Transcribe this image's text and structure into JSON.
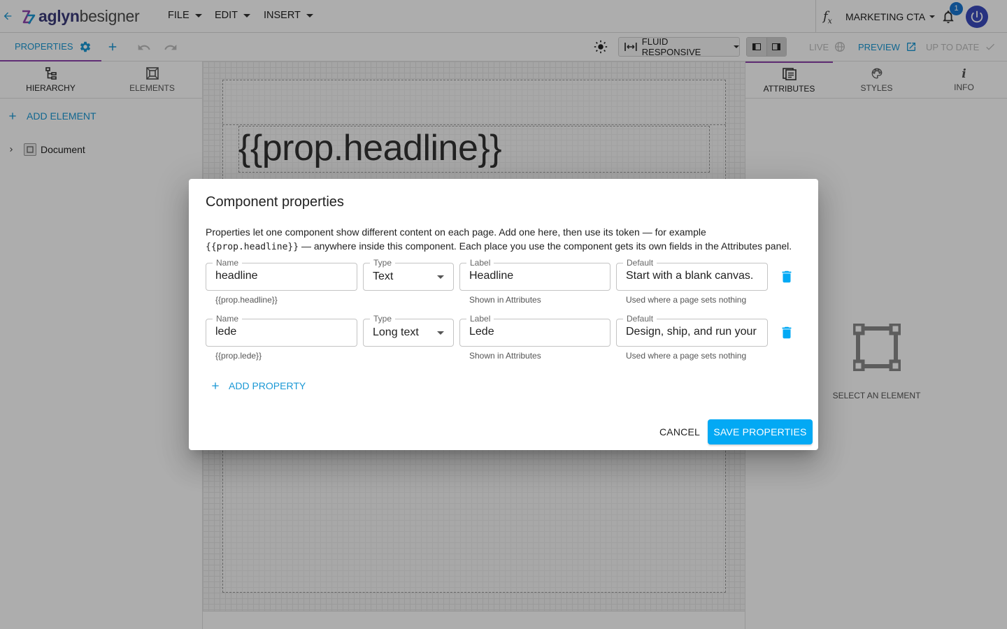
{
  "app": {
    "logo_bold": "aglyn",
    "logo_rest": "besigner",
    "brand_color": "#3a3a7a",
    "accent": "#03a9f4"
  },
  "menu": {
    "file": "FILE",
    "edit": "EDIT",
    "insert": "INSERT"
  },
  "topright": {
    "project": "MARKETING CTA",
    "notifications": "1"
  },
  "toolbar": {
    "properties_tab": "PROPERTIES",
    "viewport": "FLUID RESPONSIVE",
    "live": "LIVE",
    "preview": "PREVIEW",
    "status": "UP TO DATE"
  },
  "left_panel": {
    "tabs": [
      "HIERARCHY",
      "ELEMENTS"
    ],
    "add_element": "ADD ELEMENT",
    "tree": [
      {
        "label": "Document"
      }
    ]
  },
  "canvas": {
    "headline_token": "{{prop.headline}}"
  },
  "right_panel": {
    "tabs": [
      "ATTRIBUTES",
      "STYLES",
      "INFO"
    ],
    "empty_state": "SELECT AN ELEMENT"
  },
  "dialog": {
    "title": "Component properties",
    "description_1": "Properties let one component show different content on each page. Add one here, then use its token — for example",
    "description_code": "{{prop.headline}}",
    "description_2": "— anywhere inside this component. Each place you use the component gets its own fields in the Attributes panel.",
    "labels": {
      "name": "Name",
      "type": "Type",
      "label": "Label",
      "default": "Default"
    },
    "rows": [
      {
        "name": "headline",
        "token": "{{prop.headline}}",
        "type": "Text",
        "label": "Headline",
        "label_hint": "Shown in Attributes",
        "default": "Start with a blank canvas.",
        "default_hint": "Used where a page sets nothing"
      },
      {
        "name": "lede",
        "token": "{{prop.lede}}",
        "type": "Long text",
        "label": "Lede",
        "label_hint": "Shown in Attributes",
        "default": "Design, ship, and run your own",
        "default_hint": "Used where a page sets nothing"
      }
    ],
    "add_property": "ADD PROPERTY",
    "cancel": "CANCEL",
    "save": "SAVE PROPERTIES"
  }
}
